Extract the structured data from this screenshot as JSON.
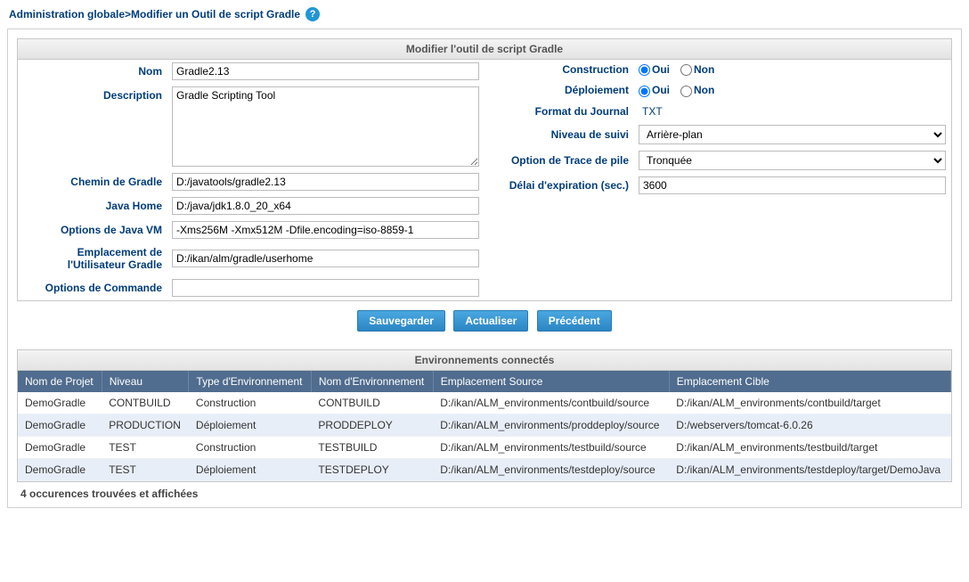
{
  "breadcrumb": {
    "root": "Administration globale",
    "current": "Modifier un Outil de script Gradle"
  },
  "panel1": {
    "title": "Modifier l'outil de script Gradle",
    "left": {
      "name_label": "Nom",
      "name_value": "Gradle2.13",
      "desc_label": "Description",
      "desc_value": "Gradle Scripting Tool",
      "gradle_path_label": "Chemin de Gradle",
      "gradle_path_value": "D:/javatools/gradle2.13",
      "java_home_label": "Java Home",
      "java_home_value": "D:/java/jdk1.8.0_20_x64",
      "jvm_opts_label": "Options de Java VM",
      "jvm_opts_value": "-Xms256M -Xmx512M -Dfile.encoding=iso-8859-1",
      "user_loc_label": "Emplacement de l'Utilisateur Gradle",
      "user_loc_value": "D:/ikan/alm/gradle/userhome",
      "cmd_opts_label": "Options de Commande",
      "cmd_opts_value": ""
    },
    "right": {
      "build_label": "Construction",
      "deploy_label": "Déploiement",
      "yes": "Oui",
      "no": "Non",
      "journal_label": "Format du Journal",
      "journal_value": "TXT",
      "trace_level_label": "Niveau de suivi",
      "trace_level_value": "Arrière-plan",
      "stack_trace_label": "Option de Trace de pile",
      "stack_trace_value": "Tronquée",
      "timeout_label": "Délai d'expiration (sec.)",
      "timeout_value": "3600"
    },
    "buttons": {
      "save": "Sauvegarder",
      "refresh": "Actualiser",
      "back": "Précédent"
    }
  },
  "panel2": {
    "title": "Environnements connectés",
    "headers": {
      "project": "Nom de Projet",
      "level": "Niveau",
      "env_type": "Type d'Environnement",
      "env_name": "Nom d'Environnement",
      "src_loc": "Emplacement Source",
      "tgt_loc": "Emplacement Cible"
    },
    "rows": [
      {
        "project": "DemoGradle",
        "level": "CONTBUILD",
        "env_type": "Construction",
        "env_name": "CONTBUILD",
        "src": "D:/ikan/ALM_environments/contbuild/source",
        "tgt": "D:/ikan/ALM_environments/contbuild/target"
      },
      {
        "project": "DemoGradle",
        "level": "PRODUCTION",
        "env_type": "Déploiement",
        "env_name": "PRODDEPLOY",
        "src": "D:/ikan/ALM_environments/proddeploy/source",
        "tgt": "D:/webservers/tomcat-6.0.26"
      },
      {
        "project": "DemoGradle",
        "level": "TEST",
        "env_type": "Construction",
        "env_name": "TESTBUILD",
        "src": "D:/ikan/ALM_environments/testbuild/source",
        "tgt": "D:/ikan/ALM_environments/testbuild/target"
      },
      {
        "project": "DemoGradle",
        "level": "TEST",
        "env_type": "Déploiement",
        "env_name": "TESTDEPLOY",
        "src": "D:/ikan/ALM_environments/testdeploy/source",
        "tgt": "D:/ikan/ALM_environments/testdeploy/target/DemoJava"
      }
    ],
    "footer": "4 occurences trouvées et affichées"
  }
}
